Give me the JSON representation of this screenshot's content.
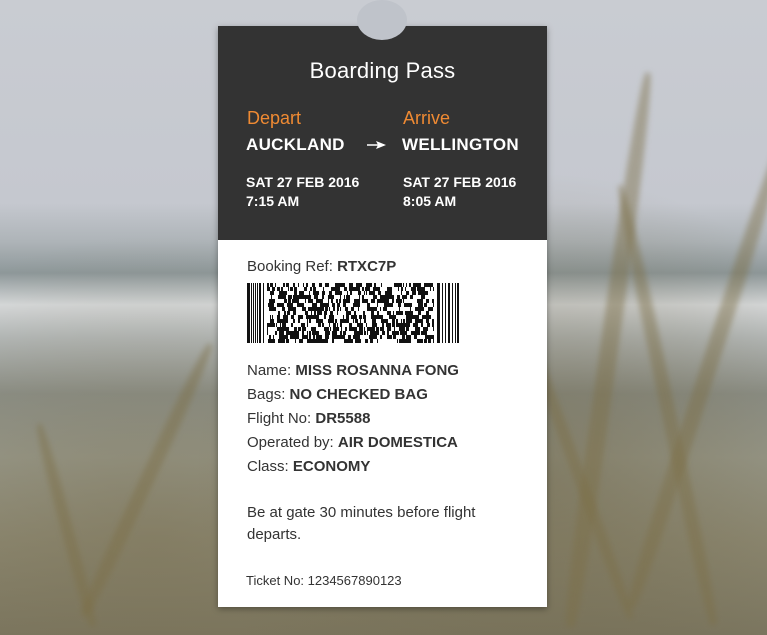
{
  "boarding_pass": {
    "title": "Boarding Pass",
    "depart": {
      "label": "Depart",
      "city": "AUCKLAND",
      "date": "SAT 27 FEB 2016",
      "time": "7:15 AM"
    },
    "arrive": {
      "label": "Arrive",
      "city": "WELLINGTON",
      "date": "SAT 27 FEB 2016",
      "time": "8:05 AM"
    },
    "booking_ref": {
      "label": "Booking Ref:",
      "value": "RTXC7P"
    },
    "passenger": {
      "name": {
        "label": "Name:",
        "value": "MISS ROSANNA FONG"
      },
      "bags": {
        "label": "Bags:",
        "value": "NO CHECKED BAG"
      },
      "flight": {
        "label": "Flight No:",
        "value": "DR5588"
      },
      "operator": {
        "label": "Operated by:",
        "value": "AIR DOMESTICA"
      },
      "class": {
        "label": "Class:",
        "value": "ECONOMY"
      }
    },
    "note": "Be at gate 30 minutes before flight departs.",
    "ticket": "Ticket No: 1234567890123",
    "icons": {
      "route": "plane-arrow-icon",
      "code": "pdf417-barcode"
    },
    "colors": {
      "header_bg": "#333333",
      "accent": "#ef8a33",
      "body_bg": "#ffffff",
      "text": "#333333"
    }
  }
}
